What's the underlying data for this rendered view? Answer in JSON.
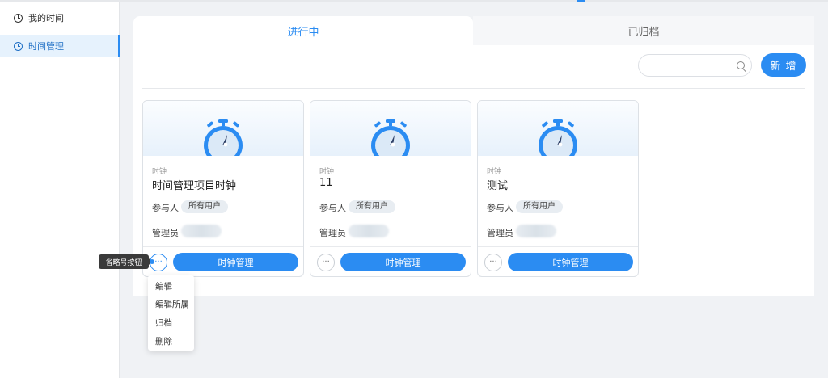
{
  "sidebar": {
    "items": [
      {
        "label": "我的时间",
        "icon": "clock-icon",
        "active": false
      },
      {
        "label": "时间管理",
        "icon": "clock-icon",
        "active": true
      }
    ]
  },
  "tabs": [
    {
      "label": "进行中",
      "active": true
    },
    {
      "label": "已归档",
      "active": false
    }
  ],
  "toolbar": {
    "search_value": "",
    "search_icon": "search-icon",
    "new_label": "新 增"
  },
  "cards": [
    {
      "type": "时钟",
      "title": "时间管理项目时钟",
      "participants_label": "参与人",
      "participants_tag": "所有用户",
      "admin_label": "管理员",
      "more_label": "···",
      "action_label": "时钟管理"
    },
    {
      "type": "时钟",
      "title": "11",
      "participants_label": "参与人",
      "participants_tag": "所有用户",
      "admin_label": "管理员",
      "more_label": "···",
      "action_label": "时钟管理"
    },
    {
      "type": "时钟",
      "title": "测试",
      "participants_label": "参与人",
      "participants_tag": "所有用户",
      "admin_label": "管理员",
      "more_label": "···",
      "action_label": "时钟管理"
    }
  ],
  "tooltip": {
    "text": "省略号按钮"
  },
  "dropdown": {
    "items": [
      "编辑",
      "编辑所属",
      "归档",
      "删除"
    ]
  },
  "colors": {
    "accent": "#2b8cf2",
    "background": "#f0f2f5"
  }
}
